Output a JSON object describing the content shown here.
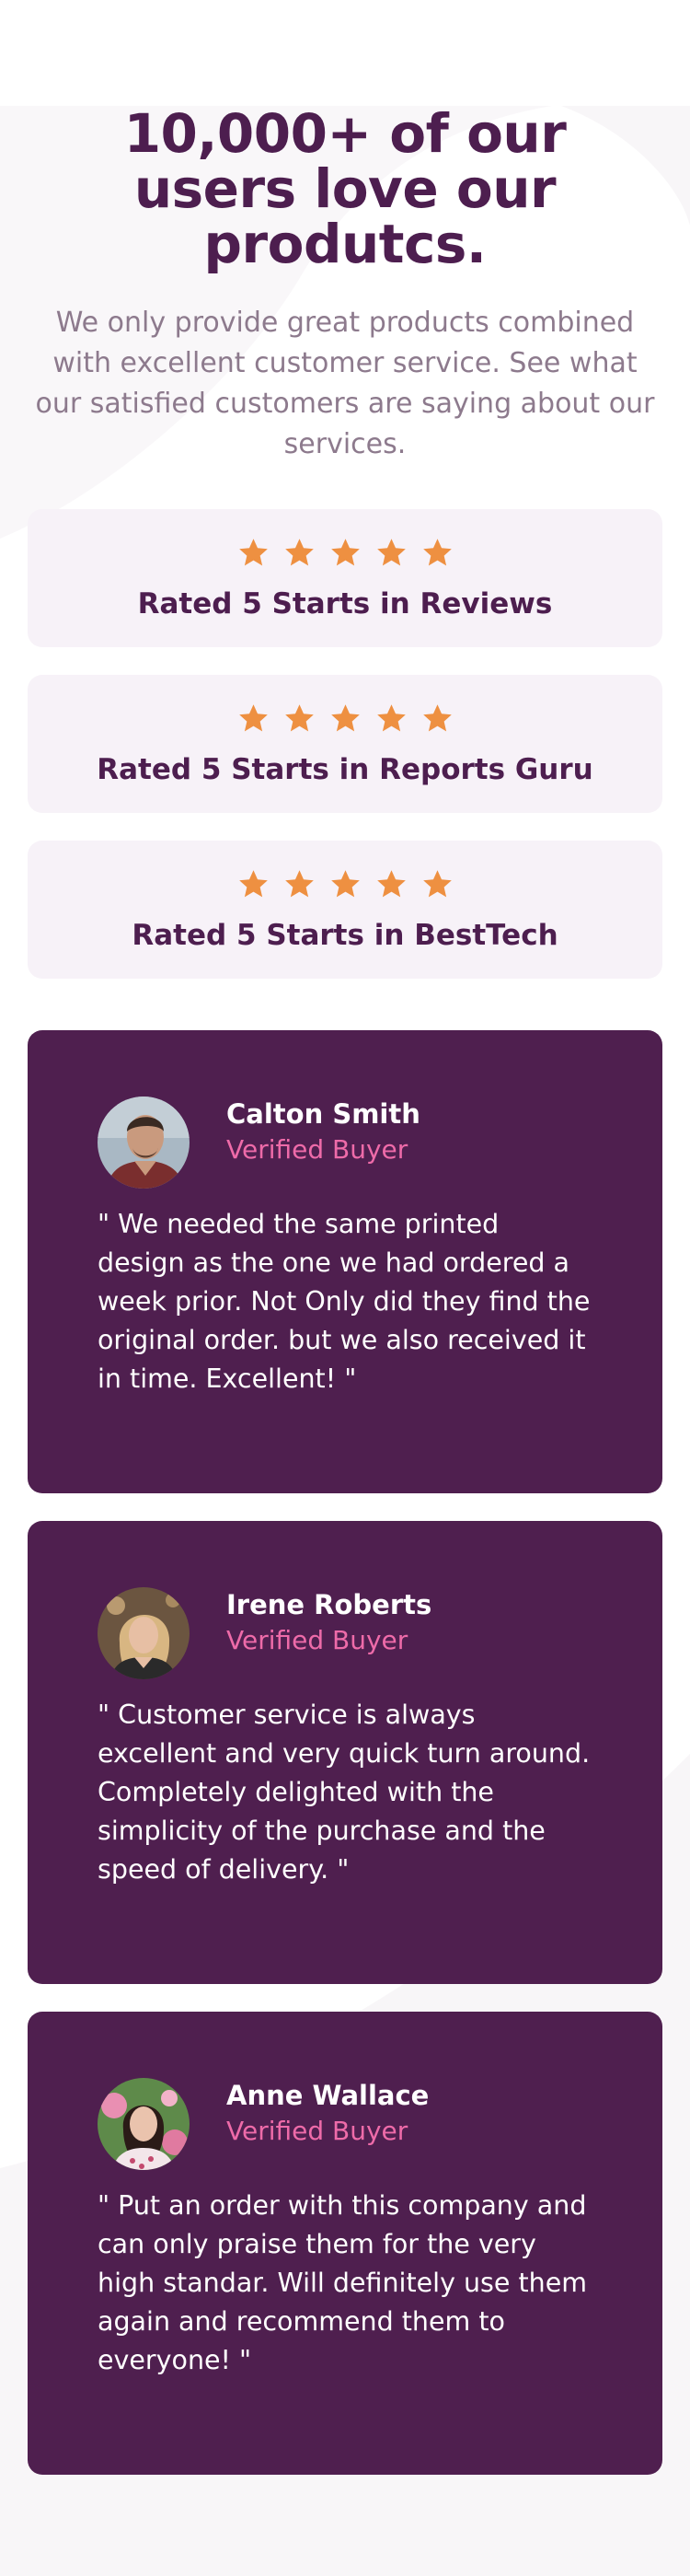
{
  "hero": {
    "title": "10,000+ of our users love our produtcs.",
    "description": "We only provide great products combined with excellent customer service. See what our satisfied customers are saying about our services."
  },
  "colors": {
    "primary": "#4d1e4f",
    "accent_pink": "#ee6ba9",
    "star": "#ee9041",
    "card_bg": "#f7f2f8"
  },
  "ratings": [
    {
      "stars": 5,
      "label": "Rated 5 Starts in Reviews"
    },
    {
      "stars": 5,
      "label": "Rated 5 Starts in Reports Guru"
    },
    {
      "stars": 5,
      "label": "Rated 5 Starts in BestTech"
    }
  ],
  "testimonials": [
    {
      "name": "Calton Smith",
      "status": "Verified Buyer",
      "avatar": "avatar-calton-icon",
      "quote": "\" We needed the same printed design as the one we had ordered a week prior. Not Only did they find the original order. but we also received it in time. Excellent! \""
    },
    {
      "name": "Irene Roberts",
      "status": "Verified Buyer",
      "avatar": "avatar-irene-icon",
      "quote": "\" Customer service is always excellent and very quick turn around. Completely delighted with the simplicity of the purchase and the speed of delivery. \""
    },
    {
      "name": "Anne Wallace",
      "status": "Verified Buyer",
      "avatar": "avatar-anne-icon",
      "quote": "\" Put an order with this company and can only praise them for the very high standar. Will definitely use them again and recommend them to everyone! \""
    }
  ]
}
